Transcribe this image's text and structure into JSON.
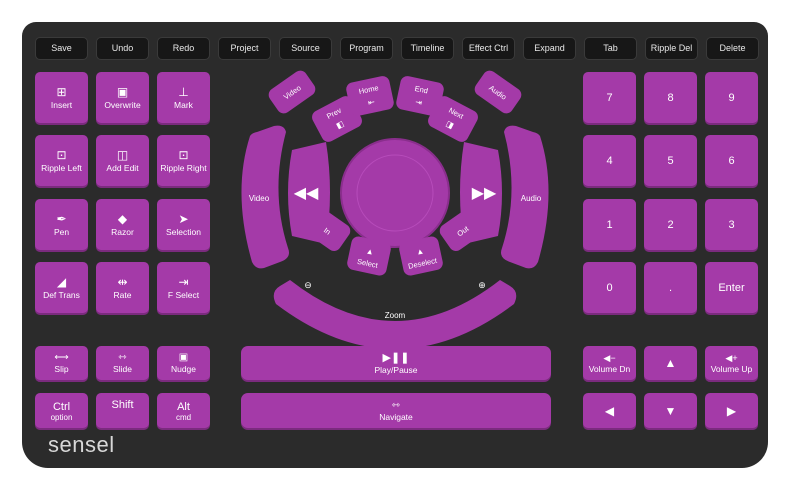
{
  "top_row": [
    "Save",
    "Undo",
    "Redo",
    "Project",
    "Source",
    "Program",
    "Timeline",
    "Effect Ctrl",
    "Expand",
    "Tab",
    "Ripple Del",
    "Delete"
  ],
  "left_keys": {
    "insert": "Insert",
    "overwrite": "Overwrite",
    "mark": "Mark",
    "ripple_left": "Ripple Left",
    "add_edit": "Add Edit",
    "ripple_right": "Ripple Right",
    "pen": "Pen",
    "razor": "Razor",
    "selection": "Selection",
    "def_trans": "Def Trans",
    "rate": "Rate",
    "f_select": "F Select",
    "slip": "Slip",
    "slide": "Slide",
    "nudge": "Nudge"
  },
  "modifiers": {
    "ctrl": "Ctrl",
    "ctrl_sub": "option",
    "shift": "Shift",
    "alt": "Alt",
    "alt_sub": "cmd"
  },
  "wheel": {
    "video_btn": "Video",
    "prev": "Prev",
    "home": "Home",
    "end": "End",
    "next": "Next",
    "audio_btn": "Audio",
    "video_arc": "Video",
    "audio_arc": "Audio",
    "in": "In",
    "select": "Select",
    "deselect": "Deselect",
    "out": "Out",
    "zoom": "Zoom"
  },
  "play_pause": "Play/Pause",
  "navigate": "Navigate",
  "numpad": [
    "7",
    "8",
    "9",
    "4",
    "5",
    "6",
    "1",
    "2",
    "3",
    "0",
    ".",
    "Enter"
  ],
  "volume_down": "Volume Dn",
  "volume_up": "Volume Up",
  "brand": "sensel",
  "colors": {
    "purple": "#a43aa8",
    "board": "#2b2b2b",
    "key_dark": "#171717"
  }
}
